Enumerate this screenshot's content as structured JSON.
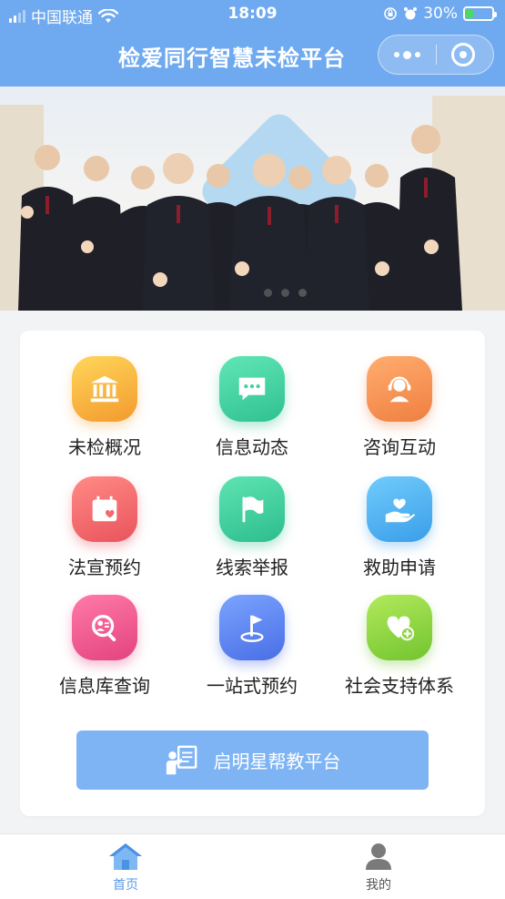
{
  "status_bar": {
    "carrier": "中国联通",
    "time": "18:09",
    "battery": "30%",
    "battery_level": 0.3
  },
  "nav": {
    "title": "检爱同行智慧未检平台"
  },
  "banner": {
    "slide_count": 3,
    "active_slide": 3
  },
  "menu": {
    "items": [
      {
        "label": "未检概况",
        "icon": "courthouse-icon",
        "color": "#f3b545"
      },
      {
        "label": "信息动态",
        "icon": "chat-bubble-icon",
        "color": "#3fd2a4"
      },
      {
        "label": "咨询互动",
        "icon": "headset-user-icon",
        "color": "#f1965a"
      },
      {
        "label": "法宣预约",
        "icon": "calendar-heart-icon",
        "color": "#ef6b6e"
      },
      {
        "label": "线索举报",
        "icon": "flag-icon",
        "color": "#3ccf9e"
      },
      {
        "label": "救助申请",
        "icon": "hand-heart-icon",
        "color": "#4fb3f0"
      },
      {
        "label": "信息库查询",
        "icon": "search-database-icon",
        "color": "#ef5a8e"
      },
      {
        "label": "一站式预约",
        "icon": "location-flag-icon",
        "color": "#5d86f0"
      },
      {
        "label": "社会支持体系",
        "icon": "heart-plus-icon",
        "color": "#8fd446"
      }
    ]
  },
  "cta": {
    "label": "启明星帮教平台",
    "icon": "teacher-board-icon"
  },
  "tabbar": {
    "home_label": "首页",
    "mine_label": "我的",
    "active_color": "#5a9ae8"
  }
}
